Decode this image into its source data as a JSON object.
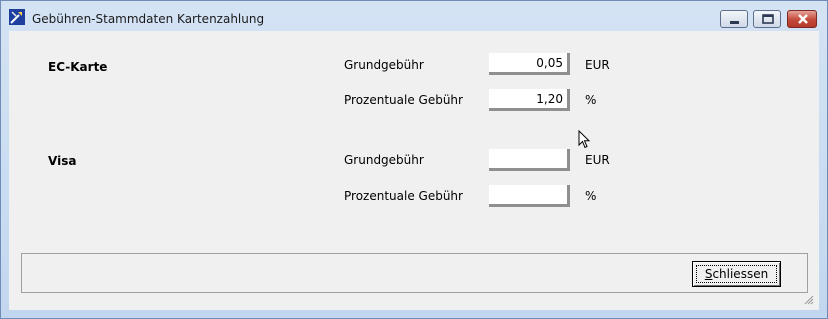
{
  "window": {
    "title": "Gebühren-Stammdaten Kartenzahlung",
    "controls": {
      "minimize": "minimize-icon",
      "maximize": "maximize-icon",
      "close": "close-icon"
    }
  },
  "sections": [
    {
      "name": "EC-Karte",
      "rows": [
        {
          "label": "Grundgebühr",
          "value": "0,05",
          "unit": "EUR"
        },
        {
          "label": "Prozentuale Gebühr",
          "value": "1,20",
          "unit": "%"
        }
      ]
    },
    {
      "name": "Visa",
      "rows": [
        {
          "label": "Grundgebühr",
          "value": "",
          "unit": "EUR"
        },
        {
          "label": "Prozentuale Gebühr",
          "value": "",
          "unit": "%"
        }
      ]
    }
  ],
  "footer": {
    "close_button_mnemonic": "S",
    "close_button_rest": "chliessen"
  },
  "colors": {
    "dialog_background": "#f0f0f0",
    "title_bar": "#c8dcf2",
    "close_button": "#c44a3b"
  }
}
